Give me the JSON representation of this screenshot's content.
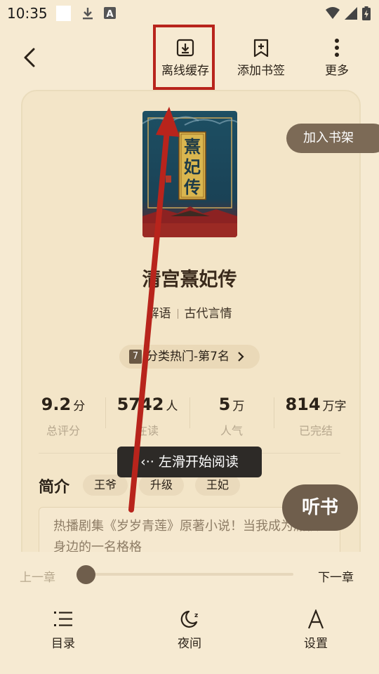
{
  "status_bar": {
    "time": "10:35",
    "icons": [
      "notification-blank-icon",
      "download-icon",
      "a-square-icon",
      "wifi-icon",
      "signal-icon",
      "battery-charging-icon"
    ]
  },
  "header": {
    "back_icon": "back-arrow-icon",
    "actions": [
      {
        "label": "离线缓存",
        "icon": "offline-download-icon"
      },
      {
        "label": "添加书签",
        "icon": "bookmark-add-icon"
      },
      {
        "label": "更多",
        "icon": "more-vertical-icon"
      }
    ]
  },
  "book": {
    "cover_title": "熹妃传",
    "title": "清宫熹妃传",
    "author": "解语",
    "category": "古代言情",
    "rank": {
      "badge": "7",
      "text": "分类热门-第7名"
    },
    "add_shelf_label": "加入书架"
  },
  "stats": [
    {
      "value": "9.2",
      "unit": "分",
      "label": "总评分"
    },
    {
      "value": "5742",
      "unit": "人",
      "label": "在读"
    },
    {
      "value": "5",
      "unit": "万",
      "label": "人气"
    },
    {
      "value": "814",
      "unit": "万字",
      "label": "已完结"
    }
  ],
  "intro": {
    "label": "简介",
    "tags": [
      "王爷",
      "升级",
      "王妃"
    ],
    "text": "热播剧集《岁岁青莲》原著小说！当我成为胤禛身边的一名格格"
  },
  "toast": {
    "text": "左滑开始阅读",
    "icon": "swipe-left-icon"
  },
  "listen_label": "听书",
  "reader": {
    "prev_label": "上一章",
    "next_label": "下一章",
    "progress": 0.0
  },
  "toolbar": [
    {
      "label": "目录",
      "icon": "catalog-list-icon"
    },
    {
      "label": "夜间",
      "icon": "moon-icon"
    },
    {
      "label": "设置",
      "icon": "font-a-icon"
    }
  ],
  "colors": {
    "background": "#f6ead2",
    "accent_brown": "#6f5e4c",
    "annotation_red": "#b8241c"
  }
}
